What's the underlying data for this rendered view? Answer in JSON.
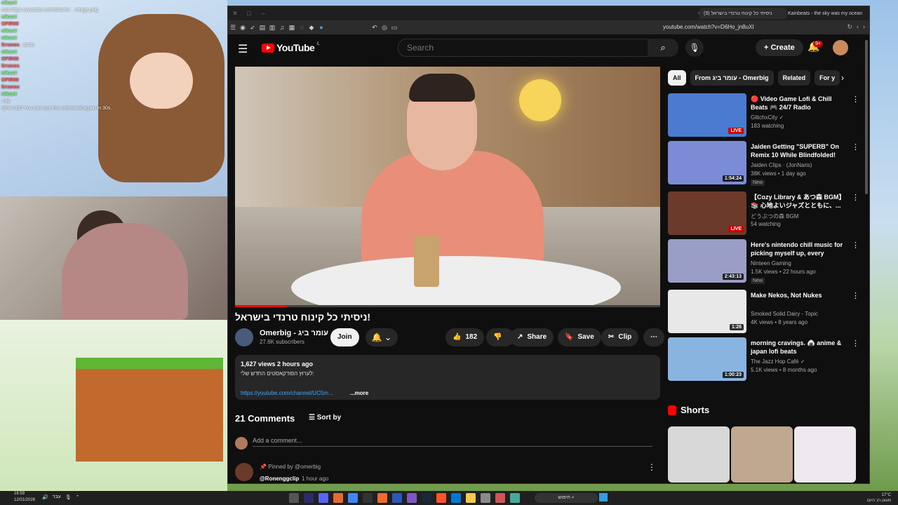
{
  "stream": {
    "chat_lines": [
      {
        "user": "nikas4",
        "msg": "",
        "color": "g"
      },
      {
        "user": "",
        "msg": "sub.https://youtube.com/shorts/... image.png",
        "color": ""
      },
      {
        "user": "nikas4",
        "msg": "",
        "color": "g"
      },
      {
        "user": "OFIR00",
        "msg": "",
        "color": "r"
      },
      {
        "user": "nikas4",
        "msg": "",
        "color": "g"
      },
      {
        "user": "nikas4",
        "msg": "",
        "color": "g"
      },
      {
        "user": "lirranos",
        "msg": ": שלום",
        "color": "r"
      },
      {
        "user": "nikas4",
        "msg": "",
        "color": "g"
      },
      {
        "user": "OFIR00",
        "msg": "",
        "color": "r"
      },
      {
        "user": "lirranos",
        "msg": "",
        "color": "r"
      },
      {
        "user": "nikas4",
        "msg": "",
        "color": "g"
      },
      {
        "user": "OFIR00",
        "msg": "",
        "color": "r"
      },
      {
        "user": "lirranos",
        "msg": "",
        "color": "r"
      },
      {
        "user": "nikas4",
        "msg": "",
        "color": "g"
      },
      {
        "user": "",
        "msg": ":clip",
        "color": ""
      },
      {
        "user": "",
        "msg": "@nirc300 You can use this command again in 30s.",
        "color": ""
      }
    ]
  },
  "browser": {
    "tabs": [
      {
        "label": "(9) ניסיתי כל קינוח טרנדי בישראל",
        "active": true
      },
      {
        "label": "Kainbeats - the sky was my ocean",
        "active": false
      }
    ],
    "url": "youtube.com/watch?v=D6Ho_jn8uXI"
  },
  "youtube": {
    "logo_text": "YouTube",
    "logo_suffix": "IL",
    "search_placeholder": "Search",
    "create_label": "Create",
    "notif_count": "9+",
    "video": {
      "title": "ניסיתי כל קינוח טרנדי בישראל!",
      "channel": "Omerbig - עומר ביג",
      "subscribers": "27.6K subscribers",
      "join_label": "Join",
      "likes": "182",
      "share_label": "Share",
      "save_label": "Save",
      "clip_label": "Clip",
      "views_time": "1,627 views  2 hours ago",
      "desc_line": "לערוץ הפודקאסטים החדש שלי:",
      "desc_link": "https://youtube.com/channel/UC5m...",
      "more_label": "...more",
      "progress": 0.12
    },
    "comments": {
      "count_label": "21 Comments",
      "sort_label": "Sort by",
      "add_placeholder": "Add a comment...",
      "pinned_label": "Pinned by @omerbig",
      "first_user": "@Ronenggclip",
      "first_time": "1 hour ago"
    },
    "chips": [
      "All",
      "From עומר ביג - Omerbig",
      "Related",
      "For y"
    ],
    "recommendations": [
      {
        "title": "🔴 Video Game Lofi & Chill Beats 🎮 24/7 Radio",
        "channel": "GlitchxCity ✓",
        "meta": "183 watching",
        "badge": "LIVE",
        "live": true,
        "new": "",
        "color": "#4a7bd0"
      },
      {
        "title": "Jaiden Getting \"SUPERB\" On Remix 10 While Blindfolded!",
        "channel": "Jaiden Clips · (JonNaris)",
        "meta": "38K views • 1 day ago",
        "badge": "1:54:24",
        "live": false,
        "new": "New",
        "color": "#7b8bd6"
      },
      {
        "title": "【Cozy Library & あつ森 BGM】📚 心地よいジャズとともに、...",
        "channel": "どうぶつの森 BGM",
        "meta": "54 watching",
        "badge": "LIVE",
        "live": true,
        "new": "",
        "color": "#6b3a2a"
      },
      {
        "title": "Here's nintendo chill music for picking myself up, every single...",
        "channel": "Ninteen Gaming",
        "meta": "1.5K views • 22 hours ago",
        "badge": "2:43:13",
        "live": false,
        "new": "New",
        "color": "#9a9ec6"
      },
      {
        "title": "Make Nekos, Not Nukes",
        "channel": "Smoked Solid Dairy - Topic",
        "meta": "4K views • 8 years ago",
        "badge": "1:26",
        "live": false,
        "new": "",
        "color": "#e8e8e8"
      },
      {
        "title": "morning cravings. 🍙 anime & japan lofi beats",
        "channel": "The Jazz Hop Café ✓",
        "meta": "5.1K views • 8 months ago",
        "badge": "1:00:23",
        "live": false,
        "new": "",
        "color": "#8ab4e0"
      }
    ],
    "shorts_label": "Shorts"
  },
  "taskbar": {
    "time": "16:59",
    "date": "12/01/2026",
    "lang": "עבר",
    "search_label": "חיפוש",
    "weather_temp": "17°C",
    "weather_desc": "מעונן רב היום"
  },
  "colors": {
    "accent": "#ff0000",
    "bg": "#0f0f0f",
    "link": "#3ea6ff"
  }
}
